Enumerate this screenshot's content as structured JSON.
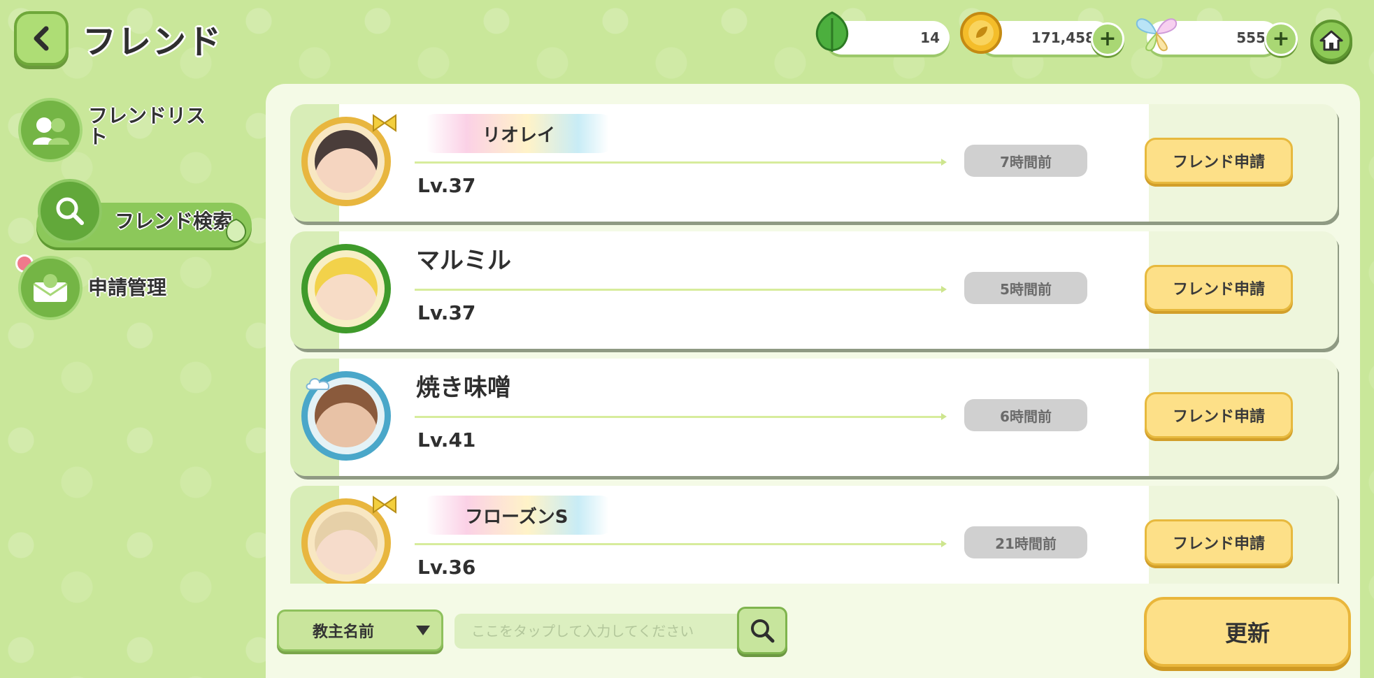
{
  "header": {
    "title": "フレンド",
    "resources": [
      {
        "icon": "leaf-icon",
        "value": "14"
      },
      {
        "icon": "gold-coin-icon",
        "value": "171,458"
      },
      {
        "icon": "butterfly-icon",
        "value": "555"
      }
    ]
  },
  "sidebar": {
    "items": [
      {
        "label": "フレンドリスト",
        "icon": "friends-icon"
      },
      {
        "label": "フレンド検索",
        "icon": "search-icon",
        "active": true
      },
      {
        "label": "申請管理",
        "icon": "envelope-icon"
      }
    ]
  },
  "friends": [
    {
      "name": "リオレイ",
      "level": "Lv.37",
      "time": "7時間前",
      "button": "フレンド申請",
      "frame_color": "#e8b63f"
    },
    {
      "name": "マルミル",
      "level": "Lv.37",
      "time": "5時間前",
      "button": "フレンド申請",
      "frame_color": "#3f9a2b"
    },
    {
      "name": "焼き味噌",
      "level": "Lv.41",
      "time": "6時間前",
      "button": "フレンド申請",
      "frame_color": "#4aa7c9"
    },
    {
      "name": "フローズンS",
      "level": "Lv.36",
      "time": "21時間前",
      "button": "フレンド申請",
      "frame_color": "#e8b63f"
    }
  ],
  "search": {
    "select_value": "教主名前",
    "placeholder": "ここをタップして入力してください",
    "refresh_label": "更新"
  },
  "colors": {
    "background": "#c9e79a",
    "accent_green": "#74b545",
    "button_yellow": "#fde088"
  }
}
